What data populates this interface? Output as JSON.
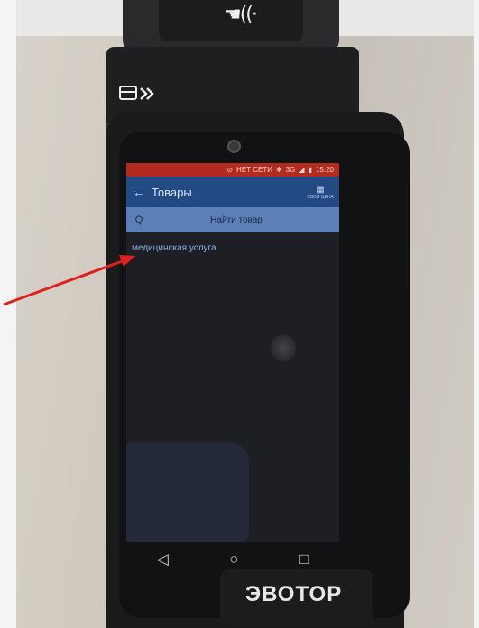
{
  "status_bar": {
    "network": "НЕТ СЕТИ",
    "signal": "3G",
    "time": "15:20",
    "background_color": "#b32b1e"
  },
  "app_bar": {
    "back_icon": "arrow-left-icon",
    "title": "Товары",
    "price_button_icon": "calculator-icon",
    "price_button_label": "СВОЯ ЦЕНА",
    "background_color": "#234a83"
  },
  "search": {
    "icon": "search-icon",
    "placeholder": "Найти товар",
    "background_color": "#5d7fb8"
  },
  "items": [
    {
      "label": "медицинская услуга"
    }
  ],
  "nav_bar": {
    "back_icon": "triangle-back-icon",
    "home_icon": "circle-home-icon",
    "recents_icon": "square-recents-icon"
  },
  "device": {
    "brand": "ЭВОТОР"
  },
  "annotation": {
    "arrow_color": "#e0201c"
  }
}
